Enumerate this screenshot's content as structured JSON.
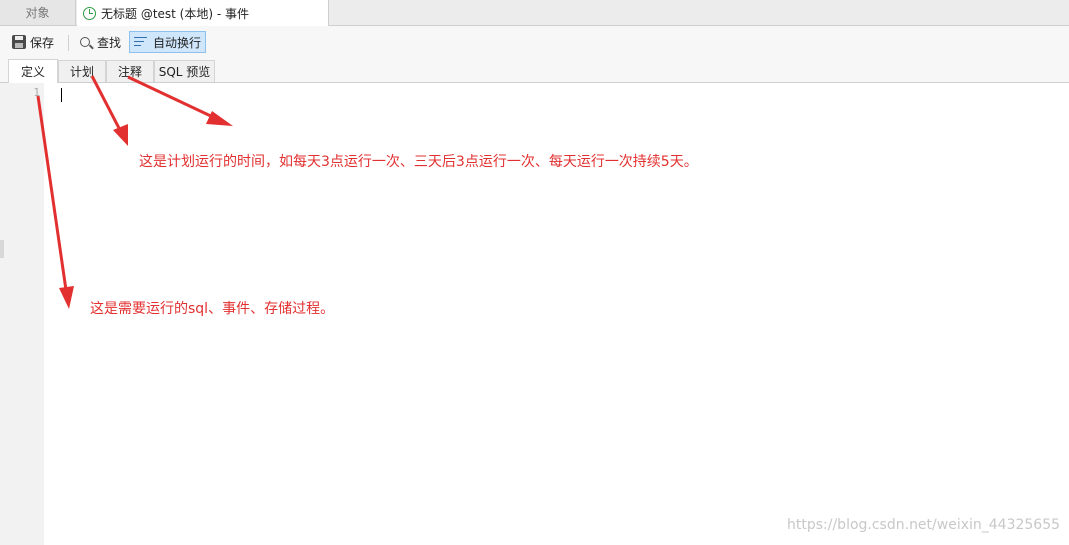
{
  "window_tabs": [
    {
      "label": "对象"
    },
    {
      "label": "无标题 @test (本地) - 事件",
      "icon": "clock-icon",
      "icon_color": "#2e9b45"
    }
  ],
  "toolbar": {
    "save_label": "保存",
    "find_label": "查找",
    "wrap_label": "自动换行"
  },
  "sub_tabs": [
    {
      "label": "定义",
      "active": true
    },
    {
      "label": "计划"
    },
    {
      "label": "注释"
    },
    {
      "label": "SQL 预览"
    }
  ],
  "editor": {
    "line_number": "1",
    "content": ""
  },
  "annotations": {
    "plan_note": "这是计划运行的时间，如每天3点运行一次、三天后3点运行一次、每天运行一次持续5天。",
    "definition_note": "这是需要运行的sql、事件、存储过程。",
    "color": "#e23030"
  },
  "watermark": "https://blog.csdn.net/weixin_44325655"
}
